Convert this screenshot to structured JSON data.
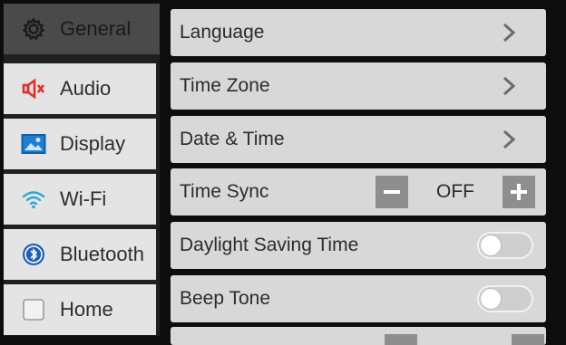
{
  "sidebar": {
    "items": [
      {
        "label": "General",
        "icon": "gear-icon",
        "active": true
      },
      {
        "label": "Audio",
        "icon": "speaker-icon",
        "active": false
      },
      {
        "label": "Display",
        "icon": "image-icon",
        "active": false
      },
      {
        "label": "Wi-Fi",
        "icon": "wifi-icon",
        "active": false
      },
      {
        "label": "Bluetooth",
        "icon": "bluetooth-icon",
        "active": false
      },
      {
        "label": "Home",
        "icon": "home-icon",
        "active": false
      }
    ]
  },
  "settings": {
    "rows": [
      {
        "label": "Language",
        "control": "chevron"
      },
      {
        "label": "Time Zone",
        "control": "chevron"
      },
      {
        "label": "Date & Time",
        "control": "chevron"
      },
      {
        "label": "Time Sync",
        "control": "stepper",
        "value": "OFF"
      },
      {
        "label": "Daylight Saving Time",
        "control": "toggle",
        "on": false
      },
      {
        "label": "Beep Tone",
        "control": "toggle",
        "on": false
      }
    ]
  },
  "colors": {
    "active_sidebar_bg": "#4a4a4a",
    "sidebar_bg": "#e4e4e4",
    "row_bg": "#d8d8d8",
    "stepper_button": "#8e8e8e",
    "audio_icon": "#e0302a",
    "accent_blue": "#1e7fd0"
  }
}
